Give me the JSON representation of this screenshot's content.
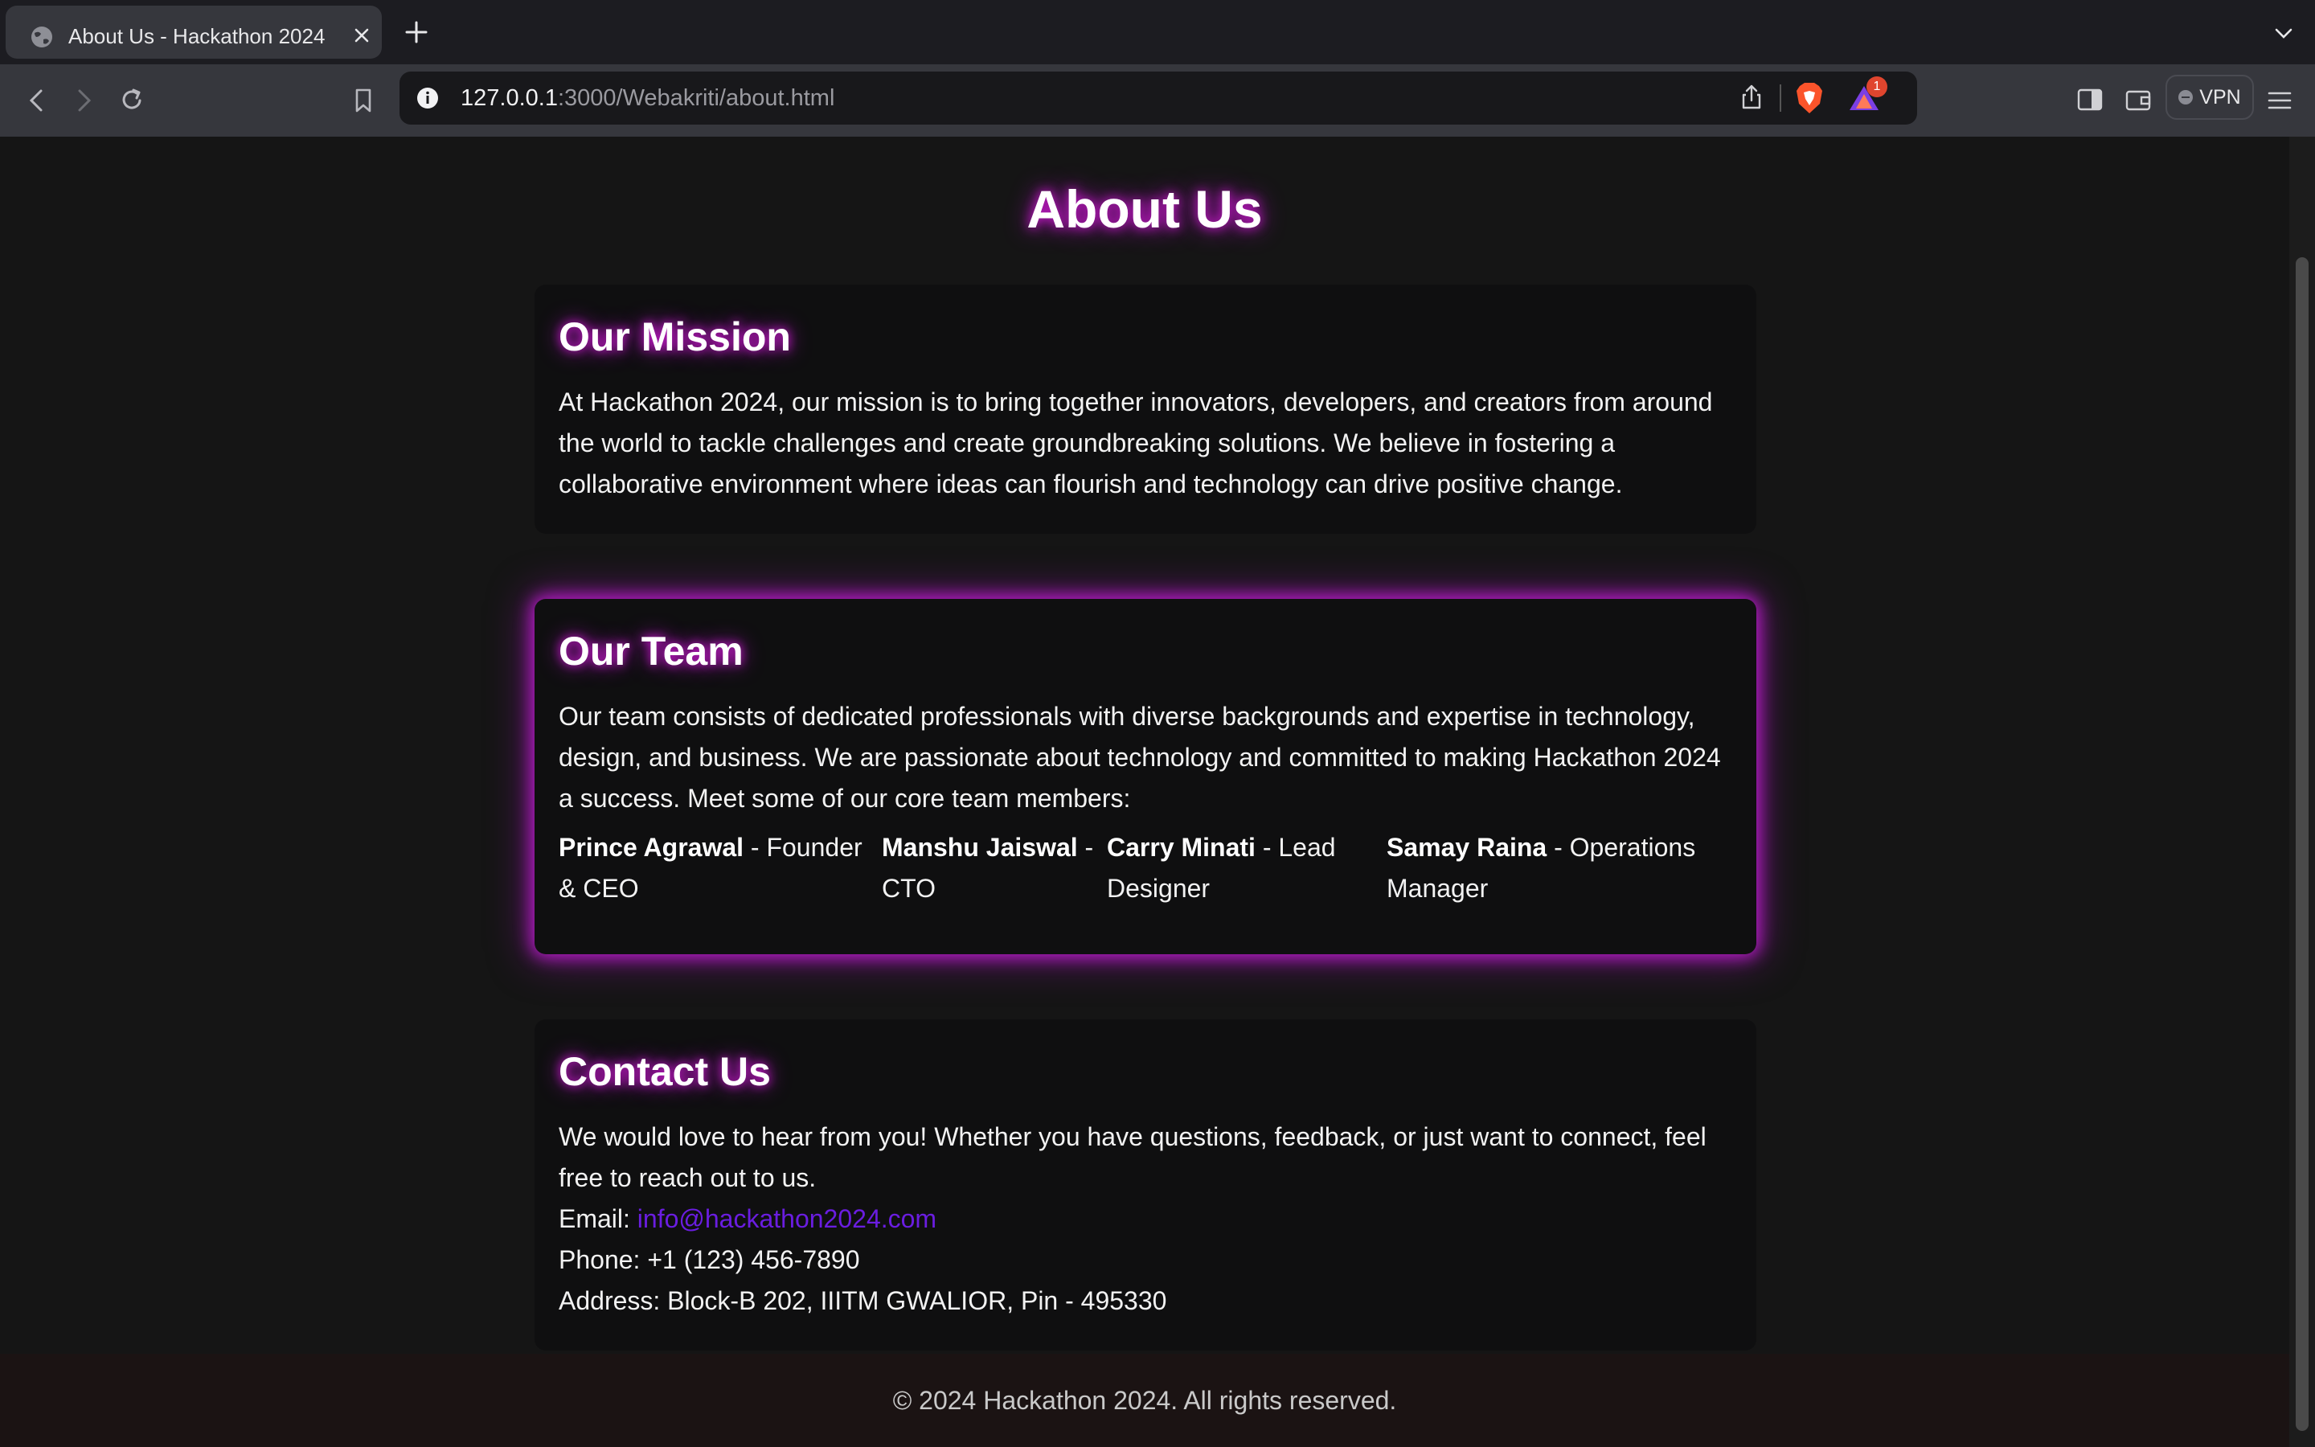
{
  "browser": {
    "tab_title": "About Us - Hackathon 2024",
    "url_host": "127.0.0.1",
    "url_path": ":3000/Webakriti/about.html",
    "rewards_badge": "1",
    "vpn_label": "VPN"
  },
  "page": {
    "title": "About Us",
    "mission": {
      "heading": "Our Mission",
      "text": "At Hackathon 2024, our mission is to bring together innovators, developers, and creators from around the world to tackle challenges and create groundbreaking solutions. We believe in fostering a collaborative environment where ideas can flourish and technology can drive positive change."
    },
    "team": {
      "heading": "Our Team",
      "text": "Our team consists of dedicated professionals with diverse backgrounds and expertise in technology, design, and business. We are passionate about technology and committed to making Hackathon 2024 a success. Meet some of our core team members:",
      "members": [
        {
          "name": "Prince Agrawal",
          "role": " - Founder & CEO"
        },
        {
          "name": "Manshu Jaiswal",
          "role": " - CTO"
        },
        {
          "name": "Carry Minati",
          "role": " - Lead Designer"
        },
        {
          "name": "Samay Raina",
          "role": " - Operations Manager"
        }
      ]
    },
    "contact": {
      "heading": "Contact Us",
      "text": "We would love to hear from you! Whether you have questions, feedback, or just want to connect, feel free to reach out to us.",
      "email_label": "Email: ",
      "email": "info@hackathon2024.com",
      "phone": "Phone: +1 (123) 456-7890",
      "address": "Address: Block-B 202, IIITM GWALIOR, Pin - 495330"
    },
    "footer": "© 2024 Hackathon 2024. All rights reserved."
  },
  "colors": {
    "glow": "#d31ad6",
    "link": "#6a1de0",
    "card_bg": "#0f0f10",
    "page_bg": "#151515"
  }
}
